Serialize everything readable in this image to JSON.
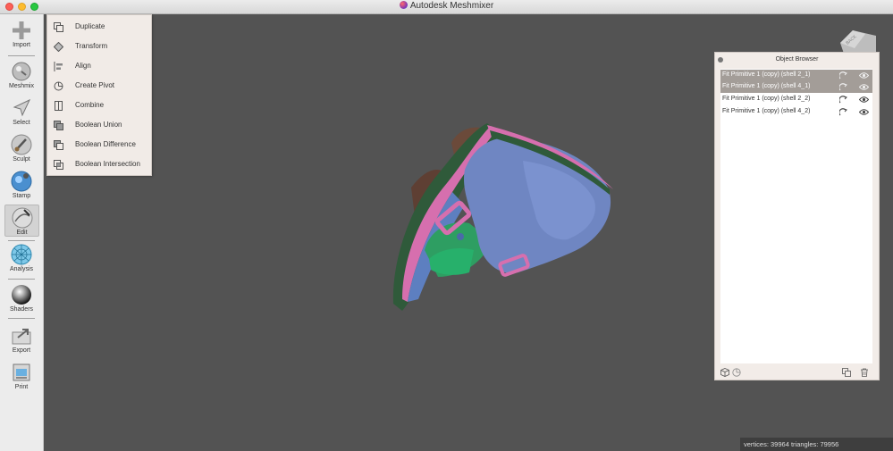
{
  "window": {
    "title": "Autodesk Meshmixer"
  },
  "toolbar": {
    "items": [
      {
        "label": "Import",
        "icon": "plus-icon"
      },
      {
        "label": "Meshmix",
        "icon": "meshmix-icon"
      },
      {
        "label": "Select",
        "icon": "select-arrow-icon"
      },
      {
        "label": "Sculpt",
        "icon": "brush-icon"
      },
      {
        "label": "Stamp",
        "icon": "stamp-icon"
      },
      {
        "label": "Edit",
        "icon": "edit-icon",
        "active": true
      },
      {
        "label": "Analysis",
        "icon": "analysis-sphere-icon"
      },
      {
        "label": "Shaders",
        "icon": "shader-sphere-icon"
      },
      {
        "label": "Export",
        "icon": "export-icon"
      },
      {
        "label": "Print",
        "icon": "printer-icon"
      }
    ]
  },
  "edit_menu": {
    "items": [
      {
        "label": "Duplicate",
        "icon": "duplicate-icon"
      },
      {
        "label": "Transform",
        "icon": "transform-icon"
      },
      {
        "label": "Align",
        "icon": "align-icon"
      },
      {
        "label": "Create Pivot",
        "icon": "pivot-icon"
      },
      {
        "label": "Combine",
        "icon": "combine-icon"
      },
      {
        "label": "Boolean Union",
        "icon": "boolean-union-icon"
      },
      {
        "label": "Boolean Difference",
        "icon": "boolean-difference-icon"
      },
      {
        "label": "Boolean Intersection",
        "icon": "boolean-intersection-icon"
      }
    ]
  },
  "view_cube": {
    "label": "BACK"
  },
  "object_browser": {
    "title": "Object Browser",
    "rows": [
      {
        "label": "Fit Primitive 1 (copy) (shell 2_1)",
        "selected": true
      },
      {
        "label": "Fit Primitive 1 (copy) (shell 4_1)",
        "selected": true
      },
      {
        "label": "Fit Primitive 1 (copy) (shell 2_2)",
        "selected": false
      },
      {
        "label": "Fit Primitive 1 (copy) (shell 4_2)",
        "selected": false
      }
    ]
  },
  "status": {
    "text": "vertices: 39964  triangles: 79956"
  },
  "colors": {
    "accent_selected": "#a39d98",
    "viewport": "#535353",
    "panel": "#f2ece8"
  }
}
